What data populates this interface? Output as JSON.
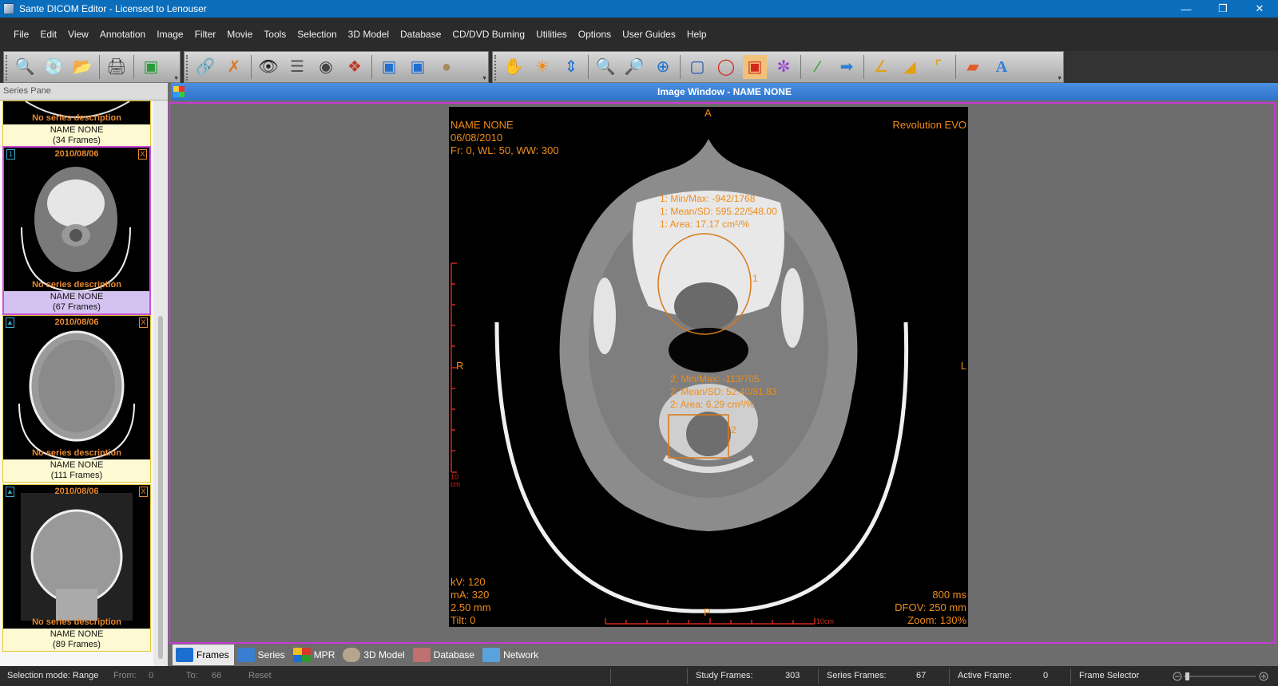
{
  "window": {
    "title": "Sante DICOM Editor - Licensed to Lenouser"
  },
  "menu": [
    "File",
    "Edit",
    "View",
    "Annotation",
    "Image",
    "Filter",
    "Movie",
    "Tools",
    "Selection",
    "3D Model",
    "Database",
    "CD/DVD Burning",
    "Utilities",
    "Options",
    "User Guides",
    "Help"
  ],
  "series_pane": {
    "header": "Series Pane",
    "cards": [
      {
        "date": "",
        "desc": "No series description",
        "name": "NAME NONE",
        "frames": "(34 Frames)"
      },
      {
        "date": "2010/08/06",
        "desc": "No series description",
        "name": "NAME NONE",
        "frames": "(67 Frames)",
        "index": "1",
        "close": "X"
      },
      {
        "date": "2010/08/06",
        "desc": "No series description",
        "name": "NAME NONE",
        "frames": "(111 Frames)",
        "index": "▲",
        "close": "X"
      },
      {
        "date": "2010/08/06",
        "desc": "No series description",
        "name": "NAME NONE",
        "frames": "(89 Frames)",
        "index": "▲",
        "close": "X"
      }
    ]
  },
  "image_window": {
    "title": "Image Window - NAME NONE",
    "overlay": {
      "top_left": [
        "NAME NONE",
        "06/08/2010",
        "Fr: 0, WL: 50, WW: 300"
      ],
      "top_right": "Revolution EVO",
      "orient_top": "A",
      "orient_left": "R",
      "orient_right": "L",
      "orient_bottom": "P",
      "bottom_left": [
        "kV: 120",
        "mA: 320",
        "2.50 mm",
        "Tilt: 0"
      ],
      "bottom_right": [
        "800 ms",
        "DFOV: 250 mm",
        "Zoom: 130%"
      ],
      "scale_left_label": "10\ncm",
      "scale_bottom_label": "10cm",
      "roi1": [
        "1: Min/Max: -942/1768",
        "1: Mean/SD: 595.22/548.00",
        "1: Area: 17.17 cm²/%"
      ],
      "roi1_tag": "1",
      "roi2": [
        "2: Min/Max: -113/705",
        "2: Mean/SD: 52.40/81.83",
        "2: Area: 6.29 cm²/%"
      ],
      "roi2_tag": "2"
    }
  },
  "tabs": [
    {
      "label": "Frames",
      "active": true,
      "color": "#1c6fd1"
    },
    {
      "label": "Series",
      "color": "#3a7fcf"
    },
    {
      "label": "MPR",
      "color": "#d8382a"
    },
    {
      "label": "3D Model",
      "color": "#b6a58c"
    },
    {
      "label": "Database",
      "color": "#c07070"
    },
    {
      "label": "Network",
      "color": "#5aa2dd"
    }
  ],
  "status": {
    "selection_mode": "Selection mode: Range",
    "from_label": "From:",
    "from_value": "0",
    "to_label": "To:",
    "to_value": "66",
    "reset": "Reset",
    "study_frames_label": "Study Frames:",
    "study_frames_value": "303",
    "series_frames_label": "Series Frames:",
    "series_frames_value": "67",
    "active_frame_label": "Active Frame:",
    "active_frame_value": "0",
    "frame_selector": "Frame Selector"
  },
  "toolbar_icons": [
    "zoom-study-icon",
    "cd-open-icon",
    "folder-open-icon",
    "print-icon",
    "window-icon",
    "link-icon",
    "unlink-icon",
    "eye-icon",
    "stack-icon",
    "mri-icon",
    "color-palette-icon",
    "fit-window-icon",
    "actual-size-icon",
    "head-3d-icon",
    "pan-hand-icon",
    "brightness-icon",
    "scroll-arrows-icon",
    "magnify-icon",
    "zoom-region-icon",
    "zoom-fit-icon",
    "rect-select-icon",
    "ellipse-roi-icon",
    "rect-roi-icon",
    "color-wheel-icon",
    "line-icon",
    "arrow-icon",
    "angle-icon",
    "cobb-angle-icon",
    "ruler-icon",
    "eraser-icon",
    "text-icon"
  ]
}
